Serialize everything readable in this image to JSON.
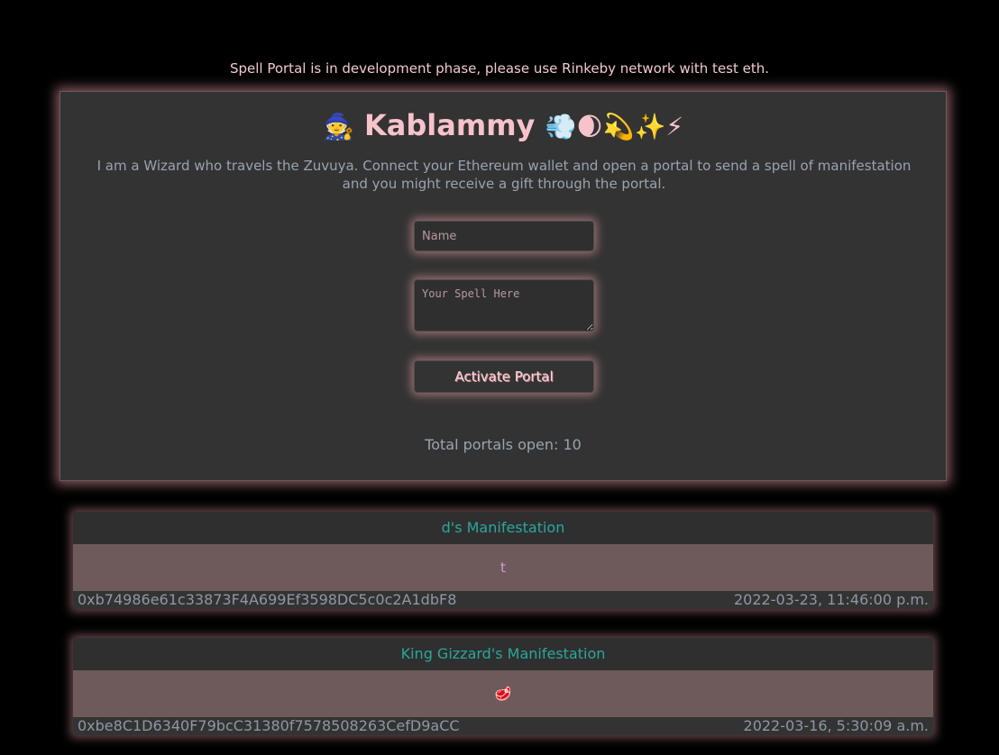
{
  "notice": "Spell Portal is in development phase, please use Rinkeby network with test eth.",
  "header": {
    "wizard_emoji": "🧙",
    "title": "Kablammy",
    "trail_emojis": "💨🌒💫✨⚡",
    "subtitle": "I am a Wizard who travels the Zuvuya. Connect your Ethereum wallet and open a portal to send a spell of manifestation and you might receive a gift through the portal."
  },
  "form": {
    "name_placeholder": "Name",
    "spell_placeholder": "Your Spell Here",
    "activate_label": "Activate Portal"
  },
  "total_portals": "Total portals open: 10",
  "spells": [
    {
      "title": "d's Manifestation",
      "message": "t",
      "address": "0xb74986e61c33873F4A699Ef3598DC5c0c2A1dbF8",
      "timestamp": "2022-03-23, 11:46:00 p.m."
    },
    {
      "title": "King Gizzard's Manifestation",
      "message": "🥩",
      "address": "0xbe8C1D6340F79bcC31380f7578508263CefD9aCC",
      "timestamp": "2022-03-16, 5:30:09 a.m."
    }
  ]
}
